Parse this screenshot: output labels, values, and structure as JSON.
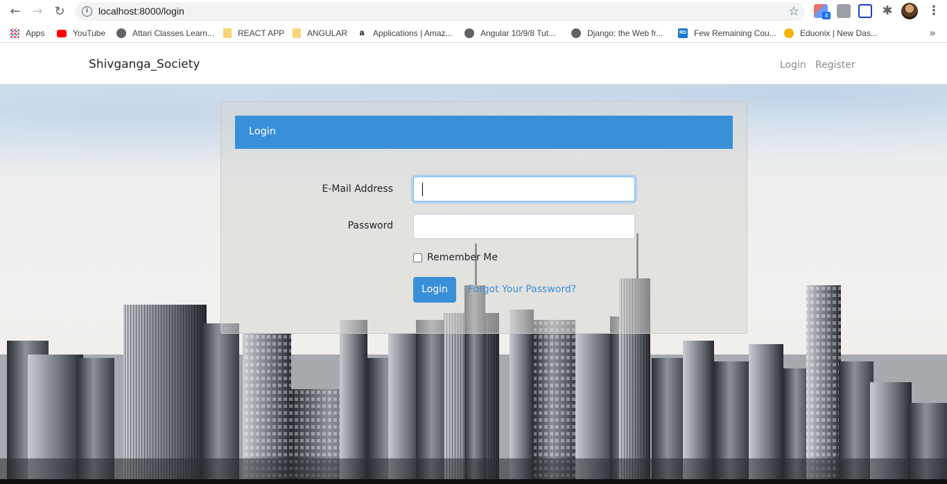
{
  "browser": {
    "url": "localhost:8000/login",
    "extension_badge": "4",
    "bookmarks": [
      {
        "label": "Apps",
        "icon": "apps-icon"
      },
      {
        "label": "YouTube",
        "icon": "youtube-icon"
      },
      {
        "label": "Attari Classes Learn...",
        "icon": "globe-icon"
      },
      {
        "label": "REACT APP",
        "icon": "folder-icon"
      },
      {
        "label": "ANGULAR",
        "icon": "folder-icon"
      },
      {
        "label": "Applications | Amaz...",
        "icon": "amazon-icon"
      },
      {
        "label": "Angular 10/9/8 Tut...",
        "icon": "globe-icon"
      },
      {
        "label": "Django: the Web fr...",
        "icon": "globe-icon"
      },
      {
        "label": "Few Remaining Cou...",
        "icon": "rd-icon"
      },
      {
        "label": "Eduonix | New Das...",
        "icon": "eduonix-icon"
      }
    ],
    "rd_icon_text": "RD"
  },
  "site": {
    "brand": "Shivganga_Society",
    "nav": {
      "login": "Login",
      "register": "Register"
    }
  },
  "login_card": {
    "header": "Login",
    "email_label": "E-Mail Address",
    "email_value": "",
    "password_label": "Password",
    "password_value": "",
    "remember_label": "Remember Me",
    "remember_checked": false,
    "submit_label": "Login",
    "forgot_label": "Forgot Your Password?"
  },
  "colors": {
    "primary": "#3a8fd9",
    "nav_link": "#8a8a8a"
  }
}
